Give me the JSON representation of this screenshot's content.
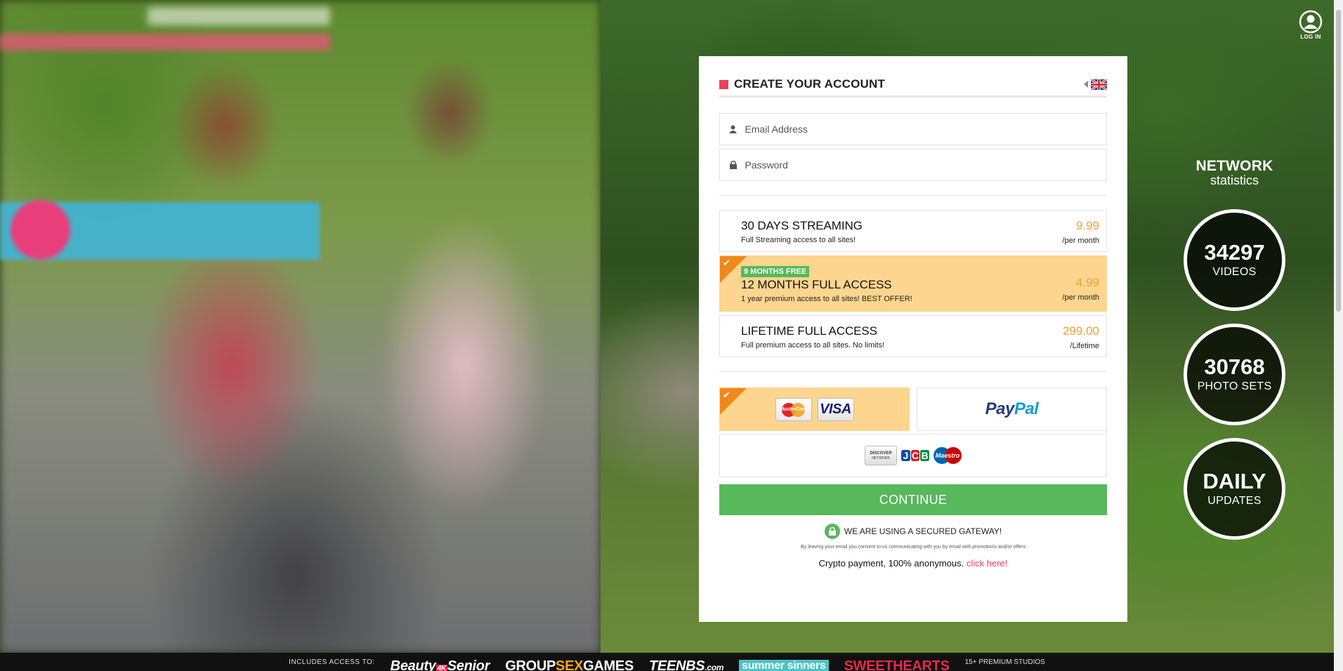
{
  "login": {
    "label": "LOG IN"
  },
  "form": {
    "title": "CREATE YOUR ACCOUNT",
    "email_placeholder": "Email Address",
    "password_placeholder": "Password"
  },
  "plans": [
    {
      "name": "30 DAYS STREAMING",
      "desc": "Full Streaming access to all sites!",
      "price": "9.99",
      "period": "/per month",
      "selected": false
    },
    {
      "badge": "9 MONTHS FREE",
      "name": "12 MONTHS FULL ACCESS",
      "desc": "1 year premium access to all sites! BEST OFFER!",
      "price": "4.99",
      "period": "/per month",
      "selected": true
    },
    {
      "name": "LIFETIME FULL ACCESS",
      "desc": "Full premium access to all sites. No limits!",
      "price": "299.00",
      "period": "/Lifetime",
      "selected": false
    }
  ],
  "payments": {
    "card_brands": [
      "MasterCard",
      "VISA"
    ],
    "paypal": {
      "p1": "Pay",
      "p2": "Pal"
    },
    "other_brands": [
      "DISCOVER",
      "JCB",
      "Maestro"
    ],
    "discover_sub": "NETWORK"
  },
  "cta": "CONTINUE",
  "secure_text": "WE ARE USING A SECURED GATEWAY!",
  "consent_text": "By leaving your email you consent to us communicating with you by email with promotions and/or offers",
  "crypto": {
    "text": "Crypto payment, 100% anonymous.",
    "link": "click here!"
  },
  "stats": {
    "heading": "NETWORK",
    "subheading": "statistics",
    "items": [
      {
        "number": "34297",
        "label": "VIDEOS"
      },
      {
        "number": "30768",
        "label": "PHOTO SETS"
      },
      {
        "number": "DAILY",
        "label": "UPDATES"
      }
    ]
  },
  "bottom": {
    "includes": "INCLUDES ACCESS TO:",
    "brands": [
      {
        "a": "Beauty",
        "b": "4K",
        "c": "Senior"
      },
      {
        "a": "GROUP",
        "b": "SEX",
        "c": "GAMES"
      },
      {
        "a": "TEENBS",
        "b": ".com"
      },
      {
        "a": "summer sinners"
      },
      {
        "a": "SWEETHEARTS"
      }
    ],
    "more": "15+ PREMIUM STUDIOS"
  },
  "colors": {
    "accent": "#ef3e5c",
    "green": "#58b85c",
    "selected": "#fdd58e",
    "price": "#f0a030",
    "corner": "#f0881a"
  }
}
